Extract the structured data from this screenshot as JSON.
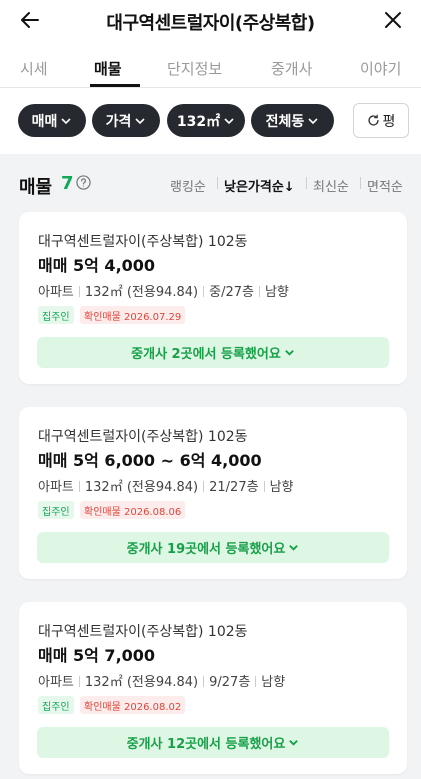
{
  "header": {
    "title": "대구역센트럴자이(주상복합)",
    "back_icon": "arrow-left-icon",
    "close_icon": "close-icon"
  },
  "tabs": [
    {
      "label": "시세",
      "active": false
    },
    {
      "label": "매물",
      "active": true
    },
    {
      "label": "단지정보",
      "active": false
    },
    {
      "label": "중개사",
      "active": false
    },
    {
      "label": "이야기",
      "active": false
    }
  ],
  "filters": {
    "chips": [
      {
        "label": "매매"
      },
      {
        "label": "가격"
      },
      {
        "label": "132㎡"
      },
      {
        "label": "전체동"
      }
    ],
    "reset_label": "평"
  },
  "list": {
    "title": "매물",
    "count": "7",
    "sorts": [
      {
        "label": "랭킹순",
        "active": false
      },
      {
        "label": "낮은가격순↓",
        "active": true
      },
      {
        "label": "최신순",
        "active": false
      },
      {
        "label": "면적순",
        "active": false
      }
    ]
  },
  "listings": [
    {
      "name": "대구역센트럴자이(주상복합) 102동",
      "price": "매매 5억 4,000",
      "type": "아파트",
      "area": "132㎡ (전용94.84)",
      "floor": "중/27층",
      "direction": "남향",
      "badge_owner": "집주인",
      "badge_confirm": "확인매물 2026.07.29",
      "agent_text": "중개사 2곳에서 등록했어요"
    },
    {
      "name": "대구역센트럴자이(주상복합) 102동",
      "price": "매매 5억 6,000 ~ 6억 4,000",
      "type": "아파트",
      "area": "132㎡ (전용94.84)",
      "floor": "21/27층",
      "direction": "남향",
      "badge_owner": "집주인",
      "badge_confirm": "확인매물 2026.08.06",
      "agent_text": "중개사 19곳에서 등록했어요"
    },
    {
      "name": "대구역센트럴자이(주상복합) 102동",
      "price": "매매 5억 7,000",
      "type": "아파트",
      "area": "132㎡ (전용94.84)",
      "floor": "9/27층",
      "direction": "남향",
      "badge_owner": "집주인",
      "badge_confirm": "확인매물 2026.08.02",
      "agent_text": "중개사 12곳에서 등록했어요"
    }
  ],
  "colors": {
    "accent_green": "#10a957",
    "agent_button_bg": "#def7e5",
    "chip_bg": "#26292f",
    "confirm_red": "#e0463b"
  }
}
